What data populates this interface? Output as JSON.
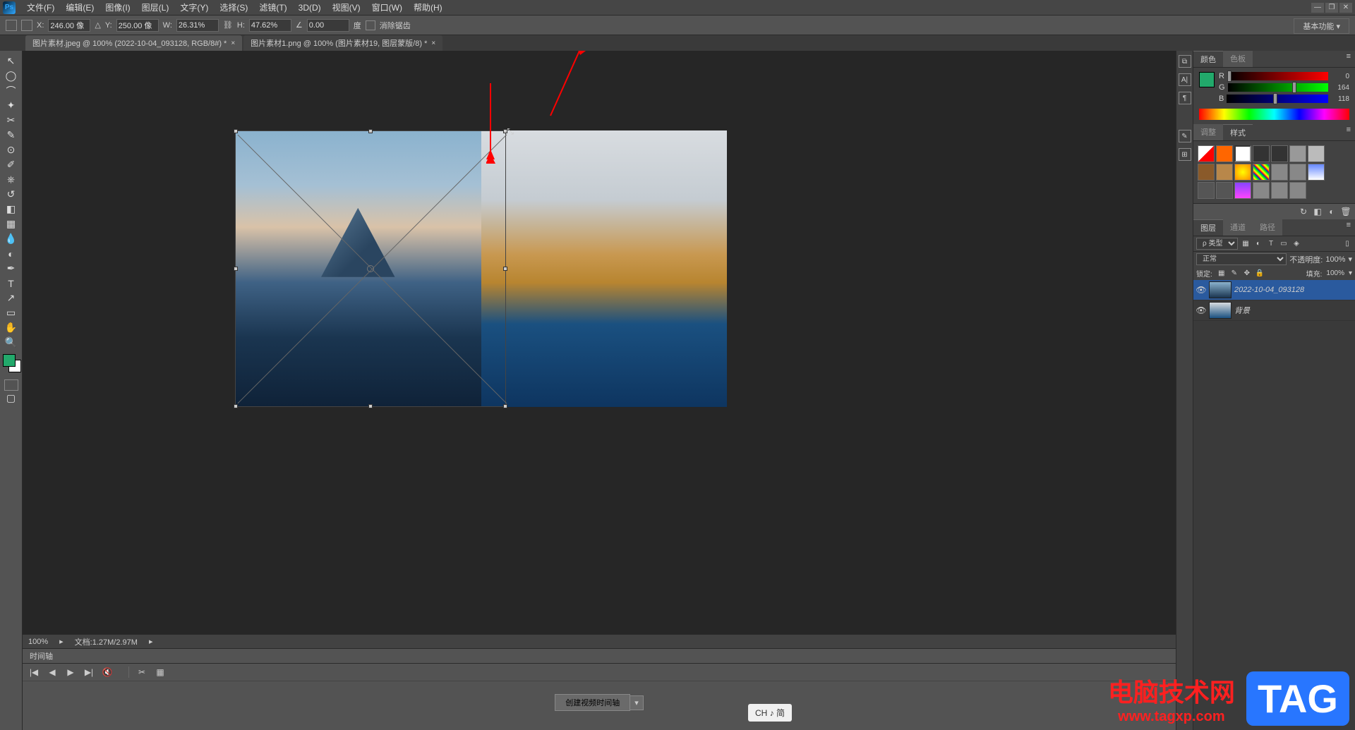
{
  "app": {
    "name": "Ps"
  },
  "menu": [
    "文件(F)",
    "编辑(E)",
    "图像(I)",
    "图层(L)",
    "文字(Y)",
    "选择(S)",
    "滤镜(T)",
    "3D(D)",
    "视图(V)",
    "窗口(W)",
    "帮助(H)"
  ],
  "workspace_selector": "基本功能",
  "options": {
    "x_label": "X:",
    "x_value": "246.00 像",
    "y_label": "Y:",
    "y_value": "250.00 像",
    "w_label": "W:",
    "w_value": "26.31%",
    "h_label": "H:",
    "h_value": "47.62%",
    "angle_label": "△",
    "angle_value": "0.00",
    "angle_unit": "度",
    "interp_label": "消除锯齿"
  },
  "tabs": [
    {
      "label": "图片素材.jpeg @ 100% (2022-10-04_093128, RGB/8#) *",
      "active": true
    },
    {
      "label": "图片素材1.png @ 100% (图片素材19, 图层蒙版/8) *",
      "active": false
    }
  ],
  "status": {
    "zoom": "100%",
    "docinfo": "文档:1.27M/2.97M"
  },
  "timeline": {
    "title": "时间轴",
    "create_btn": "创建视频时间轴"
  },
  "color_panel": {
    "tab1": "颜色",
    "tab2": "色板",
    "r_label": "R",
    "g_label": "G",
    "b_label": "B",
    "r_val": "0",
    "g_val": "164",
    "b_val": "118"
  },
  "adjust_panel": {
    "tab1": "调整",
    "tab2": "样式"
  },
  "layers_panel": {
    "tab1": "图层",
    "tab2": "通道",
    "tab3": "路径",
    "filter_kind": "ρ 类型",
    "blend_mode": "正常",
    "opacity_label": "不透明度:",
    "opacity_value": "100%",
    "lock_label": "锁定:",
    "fill_label": "填充:",
    "fill_value": "100%",
    "layers": [
      {
        "name": "2022-10-04_093128",
        "selected": true
      },
      {
        "name": "背景",
        "selected": false
      }
    ]
  },
  "ime": "CH ♪ 简",
  "watermark": {
    "title": "电脑技术网",
    "url": "www.tagxp.com",
    "tag": "TAG"
  }
}
